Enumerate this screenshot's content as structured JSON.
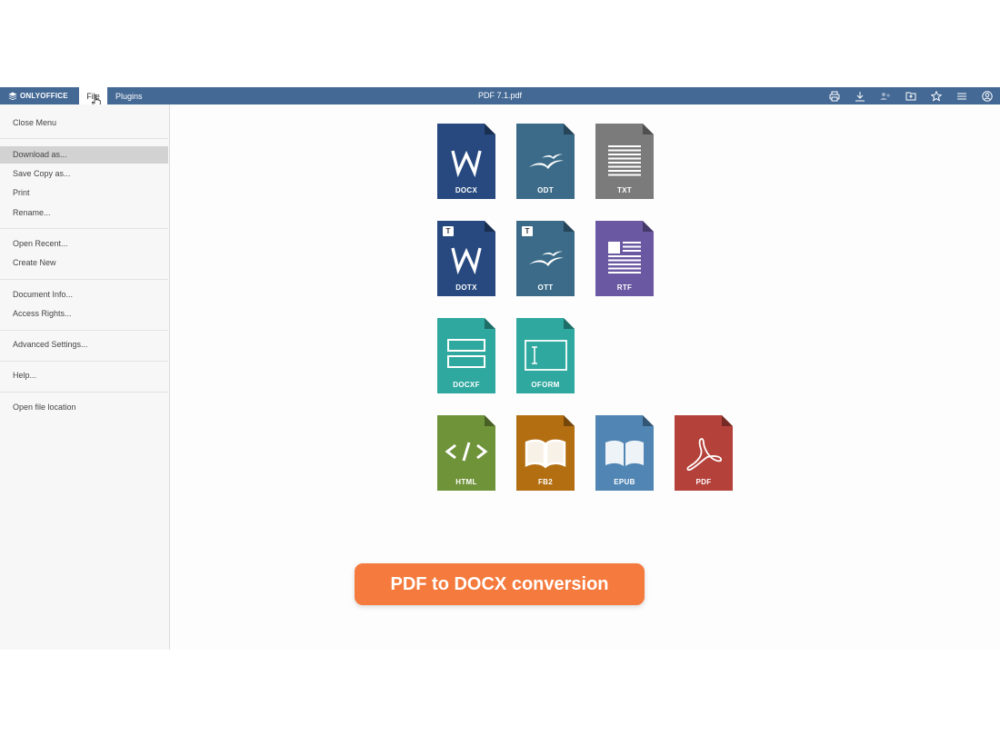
{
  "app": {
    "logo_text": "ONLYOFFICE",
    "tabs": [
      {
        "label": "File"
      },
      {
        "label": "Plugins"
      }
    ],
    "document_title": "PDF 7.1.pdf",
    "toolbar_icons": [
      "print-icon",
      "download-icon",
      "share-icon",
      "open-location-icon",
      "favorite-icon",
      "menu-icon",
      "user-icon"
    ]
  },
  "menu": {
    "items": [
      {
        "label": "Close Menu"
      },
      {
        "label": "Download as..."
      },
      {
        "label": "Save Copy as..."
      },
      {
        "label": "Print"
      },
      {
        "label": "Rename..."
      },
      {
        "label": "Open Recent..."
      },
      {
        "label": "Create New"
      },
      {
        "label": "Document Info..."
      },
      {
        "label": "Access Rights..."
      },
      {
        "label": "Advanced Settings..."
      },
      {
        "label": "Help..."
      },
      {
        "label": "Open file location"
      }
    ],
    "active_item": "Download as..."
  },
  "formats": [
    {
      "label": "DOCX",
      "color": "#27497f",
      "icon": "word-icon",
      "template": false
    },
    {
      "label": "ODT",
      "color": "#3b6b88",
      "icon": "seagull-icon",
      "template": false
    },
    {
      "label": "TXT",
      "color": "#7b7b7b",
      "icon": "text-lines-icon",
      "template": false
    },
    {
      "label": "DOTX",
      "color": "#27497f",
      "icon": "word-icon",
      "template": true
    },
    {
      "label": "OTT",
      "color": "#3b6b88",
      "icon": "seagull-icon",
      "template": true
    },
    {
      "label": "RTF",
      "color": "#6b58a3",
      "icon": "rich-text-icon",
      "template": false
    },
    {
      "label": "DOCXF",
      "color": "#2fa89f",
      "icon": "form-fields-icon",
      "template": false
    },
    {
      "label": "OFORM",
      "color": "#2fa89f",
      "icon": "form-cursor-icon",
      "template": false
    },
    {
      "label": "HTML",
      "color": "#6f9339",
      "icon": "code-icon",
      "template": false
    },
    {
      "label": "FB2",
      "color": "#b46e12",
      "icon": "book-icon",
      "template": false
    },
    {
      "label": "EPUB",
      "color": "#5085b4",
      "icon": "book-icon",
      "template": false
    },
    {
      "label": "PDF",
      "color": "#b5413b",
      "icon": "acrobat-icon",
      "template": false
    }
  ],
  "template_badge": "T",
  "caption": "PDF to DOCX conversion"
}
